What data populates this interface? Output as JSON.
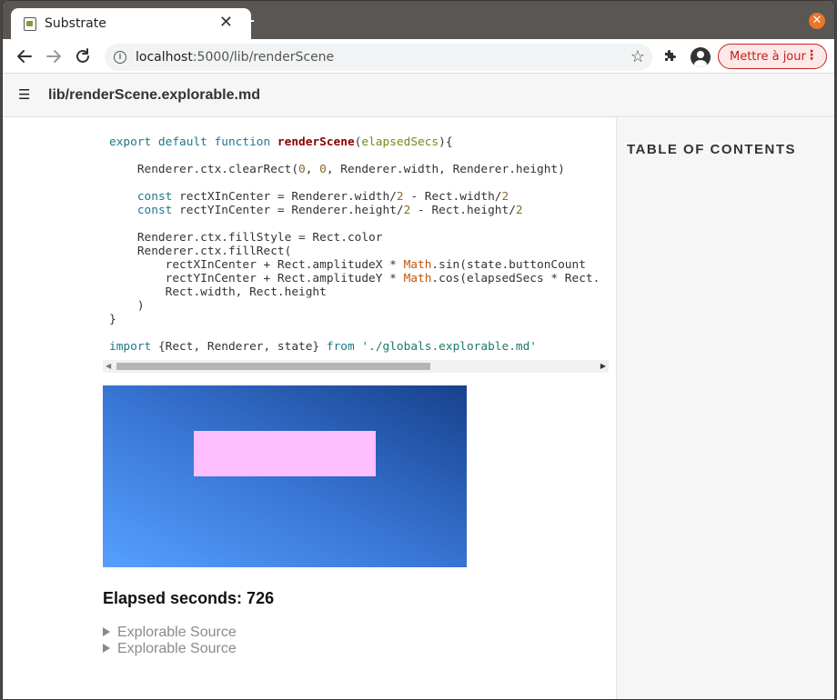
{
  "browser": {
    "tab_title": "Substrate",
    "url_host": "localhost",
    "url_path": ":5000/lib/renderScene",
    "update_label": "Mettre à jour"
  },
  "page": {
    "title": "lib/renderScene.explorable.md",
    "toc_title": "TABLE OF CONTENTS",
    "elapsed_label": "Elapsed seconds: 726",
    "details": [
      "Explorable Source",
      "Explorable Source"
    ]
  },
  "colors": {
    "rect": "#ffbfff",
    "scene_gradient": [
      "#55a0ff",
      "#17418c"
    ],
    "update_accent": "#c5221f",
    "close_button": "#e9762b"
  },
  "icons": [
    "favicon-icon",
    "close-tab-icon",
    "new-tab-icon",
    "window-close-icon",
    "back-icon",
    "forward-icon",
    "reload-icon",
    "info-icon",
    "star-icon",
    "extensions-icon",
    "profile-icon",
    "menu-dots-icon",
    "hamburger-icon"
  ]
}
